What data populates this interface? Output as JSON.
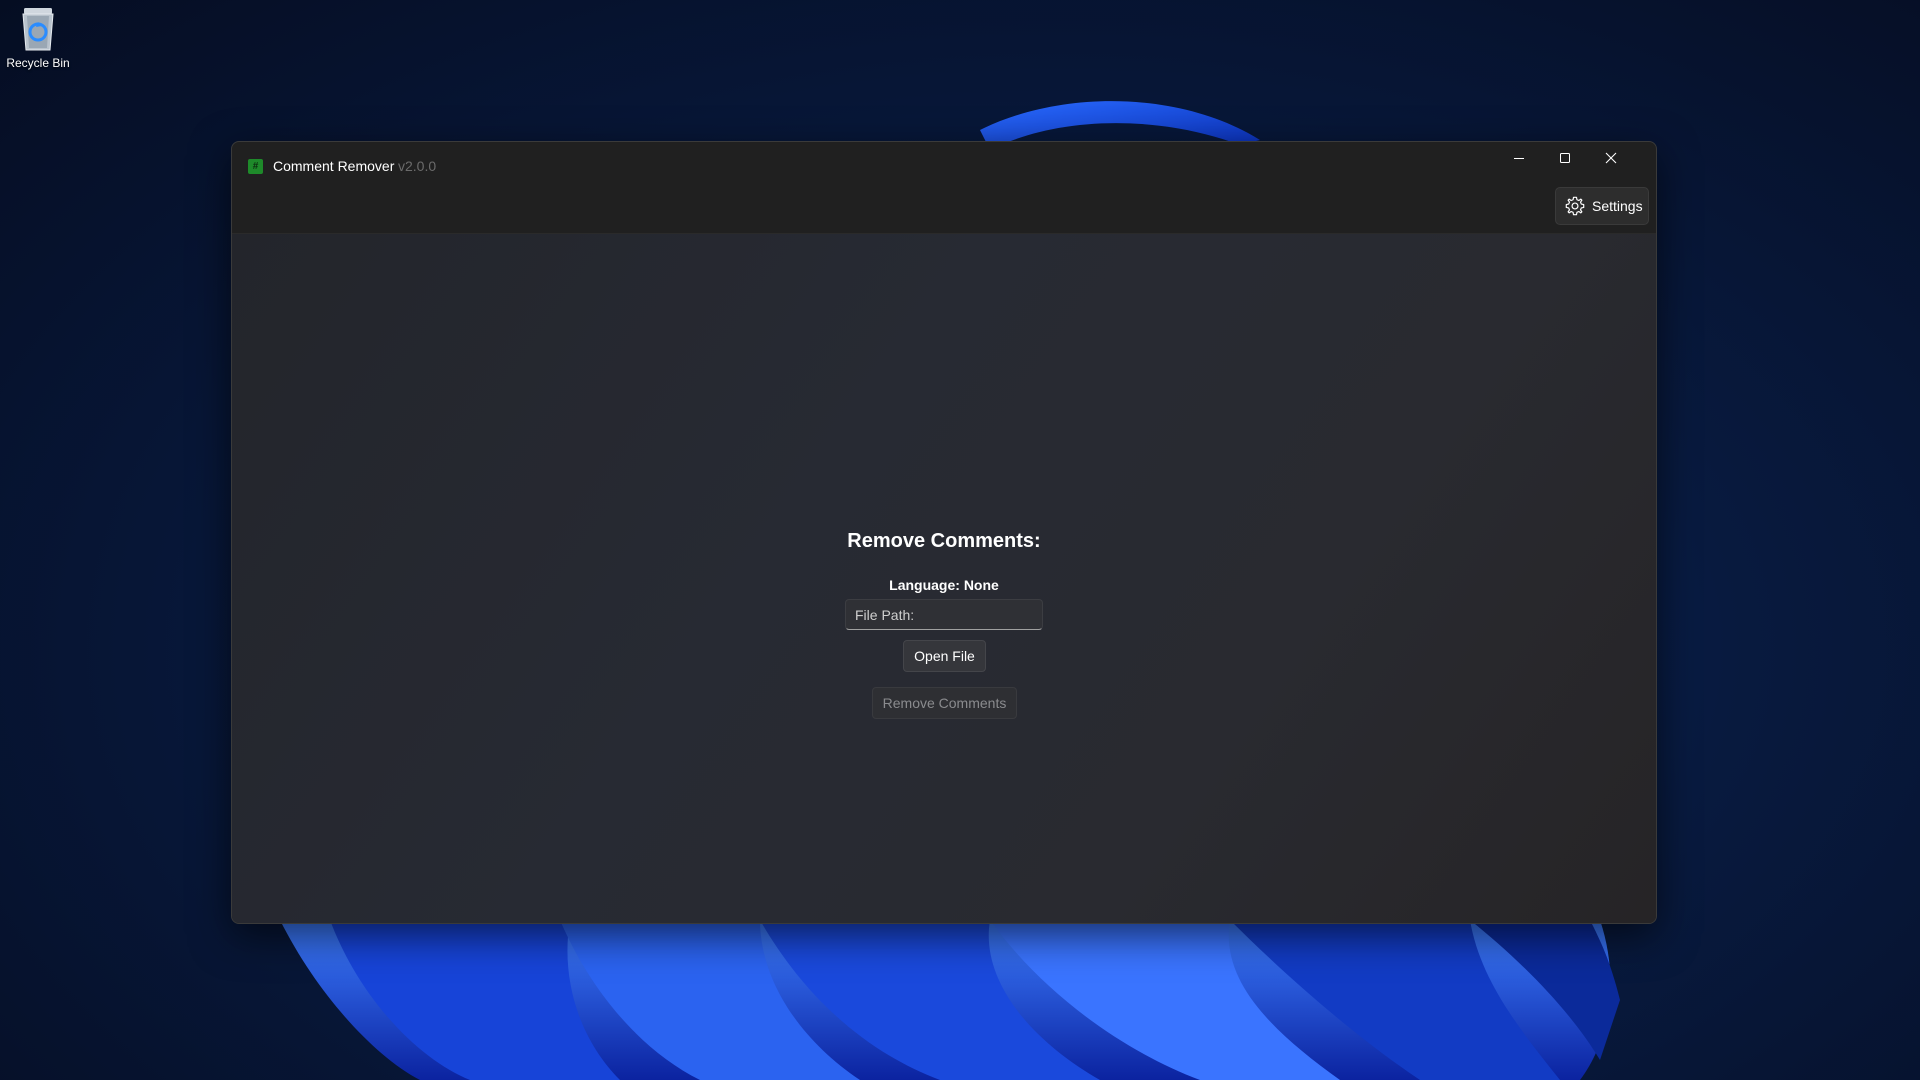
{
  "desktop": {
    "icons": [
      {
        "label": "Recycle Bin",
        "icon": "recycle-bin-icon"
      }
    ]
  },
  "window": {
    "title": "Comment Remover",
    "version": "v2.0.0",
    "app_icon_glyph": "#",
    "app_icon_color": "#1e8a2a",
    "caption_buttons": [
      "minimize",
      "maximize",
      "close"
    ],
    "toolbar": {
      "settings_label": "Settings",
      "settings_icon": "gear-icon"
    },
    "main": {
      "heading": "Remove Comments:",
      "language_text": "Language: None",
      "file_path_placeholder": "File Path:",
      "file_path_value": "",
      "open_file_label": "Open File",
      "remove_comments_label": "Remove Comments",
      "remove_comments_enabled": false
    }
  },
  "colors": {
    "wallpaper_accent": "#1f5cff",
    "window_background": "#202020",
    "content_background": "#272a33"
  }
}
